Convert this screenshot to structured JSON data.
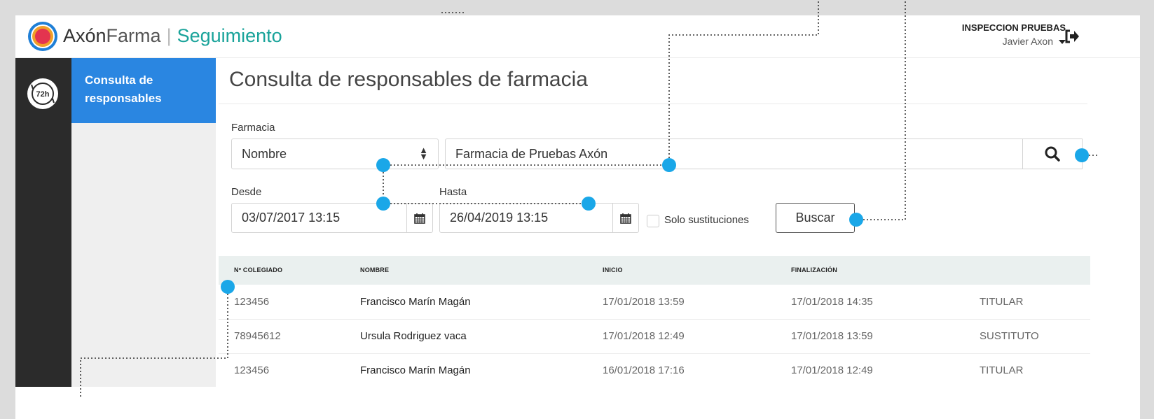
{
  "header": {
    "brand_axon": "Axón",
    "brand_farma": "Farma",
    "brand_separator": "|",
    "brand_module": "Seguimiento",
    "user_title": "INSPECCION PRUEBAS",
    "user_name": "Javier Axon",
    "logout_icon": "sign-out-icon",
    "logo_icon": "axon-logo-icon",
    "colors": {
      "module": "#19a39a",
      "logo_ring": "#f0a028",
      "logo_core": "#e3344f",
      "logo_outer": "#1f7fd6"
    }
  },
  "rail": {
    "icon": "72h-clock-icon",
    "icon_text": "72h",
    "background": "#2b2b2b"
  },
  "subnav": {
    "items": [
      {
        "label_line1": "Consulta de",
        "label_line2": "responsables",
        "active": true
      }
    ],
    "active_color": "#2a86e1"
  },
  "main": {
    "title": "Consulta de responsables de farmacia",
    "farmacia_label": "Farmacia",
    "search_by": "Nombre",
    "search_value": "Farmacia de Pruebas Axón",
    "search_icon": "search-icon",
    "desde_label": "Desde",
    "desde_value": "03/07/2017 13:15",
    "hasta_label": "Hasta",
    "hasta_value": "26/04/2019 13:15",
    "calendar_icon": "calendar-icon",
    "solo_sustituciones_label": "Solo sustituciones",
    "solo_sustituciones_checked": false,
    "buscar_label": "Buscar"
  },
  "table": {
    "headers": [
      "Nº COLEGIADO",
      "NOMBRE",
      "INICIO",
      "FINALIZACIÓN",
      ""
    ],
    "rows": [
      {
        "colegiado": "123456",
        "nombre": "Francisco Marín Magán",
        "inicio": "17/01/2018 13:59",
        "fin": "17/01/2018 14:35",
        "tipo": "TITULAR"
      },
      {
        "colegiado": "78945612",
        "nombre": "Ursula Rodriguez vaca",
        "inicio": "17/01/2018 12:49",
        "fin": "17/01/2018 13:59",
        "tipo": "SUSTITUTO"
      },
      {
        "colegiado": "123456",
        "nombre": "Francisco Marín Magán",
        "inicio": "16/01/2018 17:16",
        "fin": "17/01/2018 12:49",
        "tipo": "TITULAR"
      }
    ]
  },
  "annotation_color": "#1aa7e8"
}
